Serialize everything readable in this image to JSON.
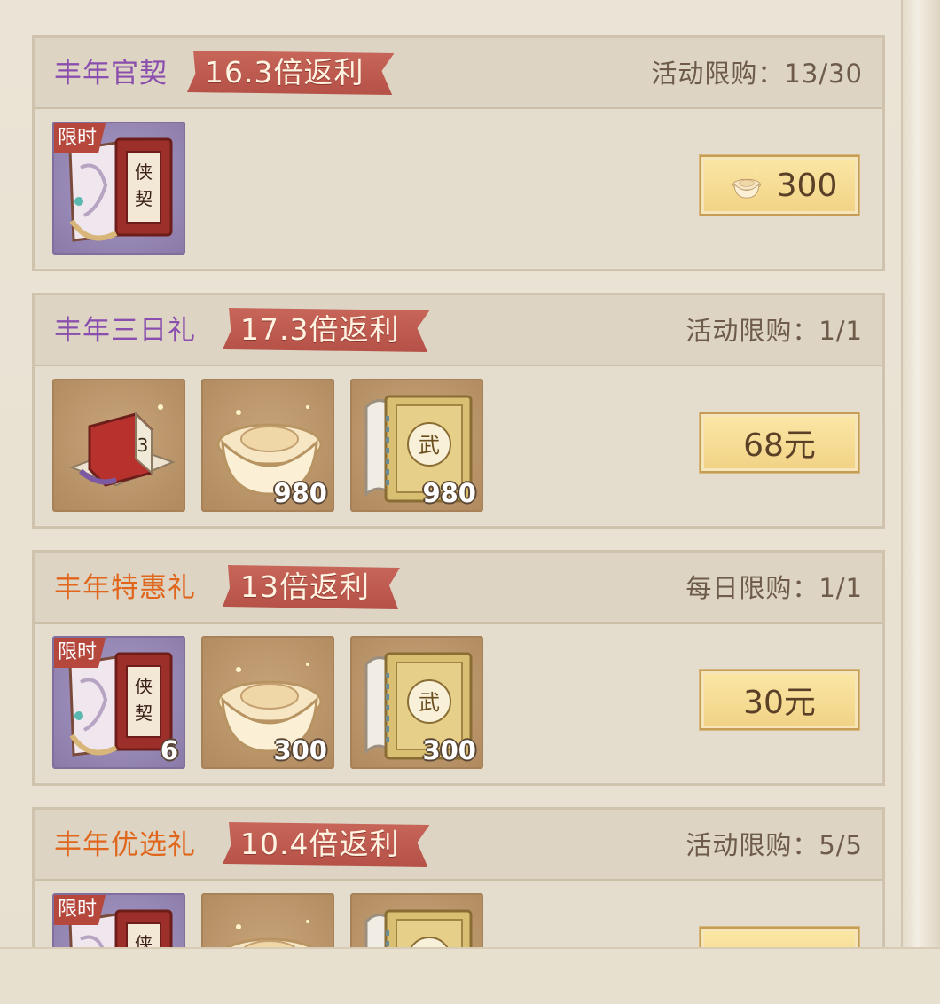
{
  "packs": [
    {
      "title": "丰年官契",
      "title_color": "#8a4fae",
      "rebate": "16.3倍返利",
      "limit": "活动限购：13/30",
      "price": "300",
      "price_icon": "ingot-icon",
      "items": [
        {
          "icon": "contract-book-icon",
          "tag": "限时",
          "count": ""
        }
      ]
    },
    {
      "title": "丰年三日礼",
      "title_color": "#8a4fae",
      "rebate": "17.3倍返利",
      "limit": "活动限购：1/1",
      "price": "68元",
      "items": [
        {
          "icon": "scroll-box-icon",
          "tag": "",
          "count": ""
        },
        {
          "icon": "ingot-icon",
          "tag": "",
          "count": "980"
        },
        {
          "icon": "skill-book-icon",
          "tag": "",
          "count": "980"
        }
      ]
    },
    {
      "title": "丰年特惠礼",
      "title_color": "#e0661c",
      "rebate": "13倍返利",
      "limit": "每日限购：1/1",
      "price": "30元",
      "items": [
        {
          "icon": "contract-book-icon",
          "tag": "限时",
          "count": "6"
        },
        {
          "icon": "ingot-icon",
          "tag": "",
          "count": "300"
        },
        {
          "icon": "skill-book-icon",
          "tag": "",
          "count": "300"
        }
      ]
    },
    {
      "title": "丰年优选礼",
      "title_color": "#e0661c",
      "rebate": "10.4倍返利",
      "limit": "活动限购：5/5",
      "price": "",
      "items": [
        {
          "icon": "contract-book-icon",
          "tag": "限时",
          "count": ""
        },
        {
          "icon": "ingot-icon",
          "tag": "",
          "count": ""
        },
        {
          "icon": "skill-book-icon",
          "tag": "",
          "count": ""
        }
      ]
    }
  ],
  "colors": {
    "ribbon": "#c0594e",
    "button": "#f7dc92",
    "panel": "#e4dccd"
  }
}
